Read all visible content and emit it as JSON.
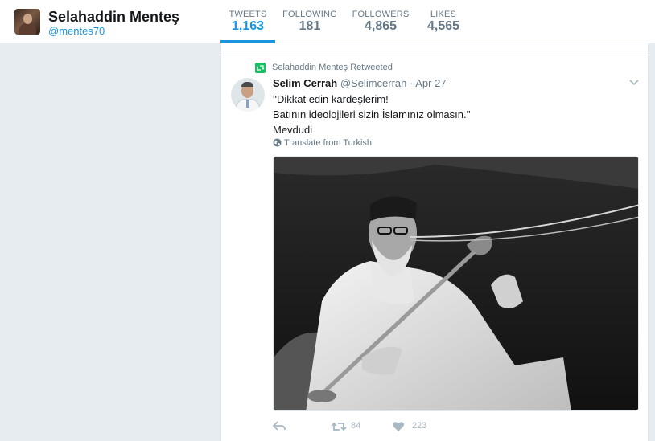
{
  "profile": {
    "name": "Selahaddin Menteş",
    "handle": "@mentes70"
  },
  "stats": [
    {
      "label": "TWEETS",
      "value": "1,163",
      "active": true
    },
    {
      "label": "FOLLOWING",
      "value": "181",
      "active": false
    },
    {
      "label": "FOLLOWERS",
      "value": "4,865",
      "active": false
    },
    {
      "label": "LIKES",
      "value": "4,565",
      "active": false
    }
  ],
  "tweet": {
    "retweeted_by": "Selahaddin Menteş Retweeted",
    "author_name": "Selim Cerrah",
    "author_handle": "@Selimcerrah",
    "separator": "·",
    "date": "Apr 27",
    "lines": [
      "''Dikkat edin kardeşlerim!",
      "Batının ideolojileri sizin İslamınız olmasın.''",
      "Mevdudi"
    ],
    "translate_label": "Translate from Turkish",
    "retweet_count": "84",
    "like_count": "223"
  },
  "colors": {
    "accent": "#1b95e0",
    "retweet_green": "#17bf63",
    "muted": "#657786",
    "background": "#e6ecf0"
  },
  "icons": [
    "reply-icon",
    "retweet-icon",
    "like-icon",
    "globe-icon",
    "chevron-down-icon"
  ]
}
